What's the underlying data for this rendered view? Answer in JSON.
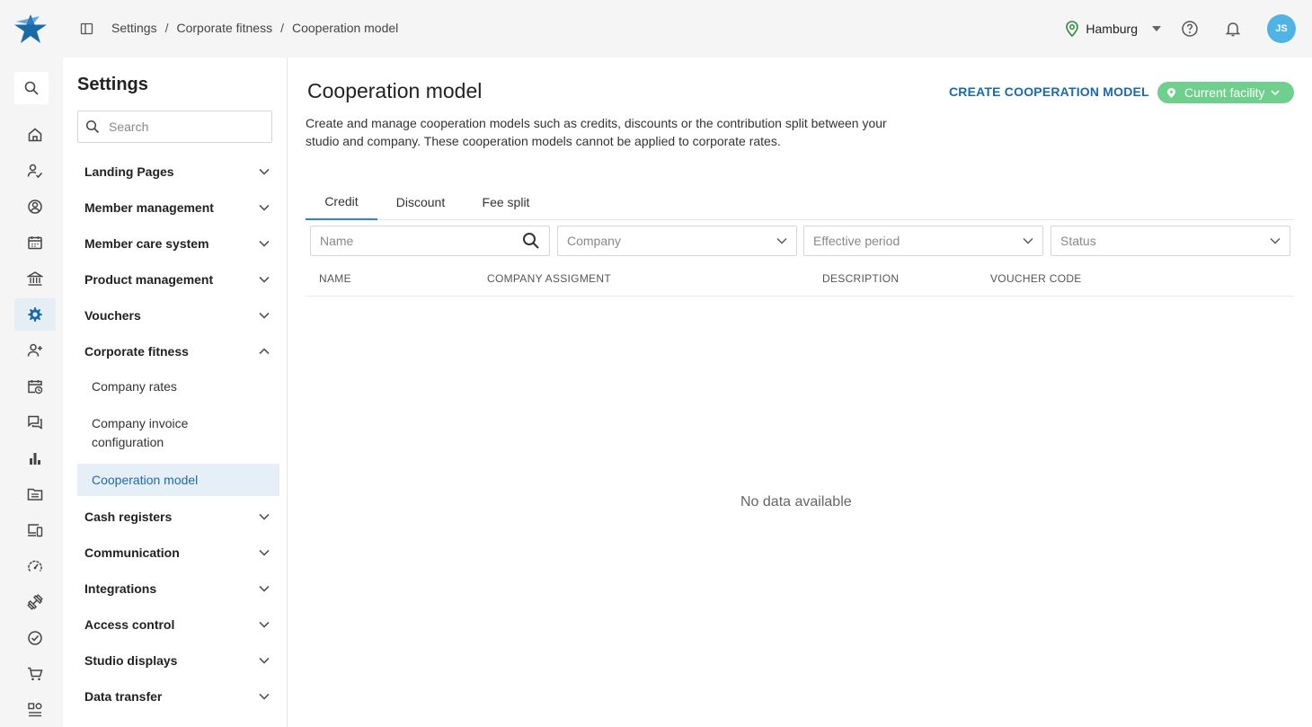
{
  "breadcrumb": [
    "Settings",
    "Corporate fitness",
    "Cooperation model"
  ],
  "header": {
    "location": "Hamburg",
    "avatar_initials": "JS",
    "colors": {
      "avatar": "#4fb3e6",
      "brand": "#1b6aa8",
      "facility": "#6fcf8c"
    }
  },
  "rail": {
    "icons": [
      "search-icon",
      "home-icon",
      "member-check-icon",
      "user-circle-icon",
      "calendar-icon",
      "bank-icon",
      "gear-icon",
      "user-add-icon",
      "calendar-clock-icon",
      "chat-icon",
      "bar-chart-icon",
      "folder-icon",
      "devices-icon",
      "gauge-icon",
      "dumbbell-icon",
      "check-circle-icon",
      "cart-icon",
      "more-icon"
    ],
    "active": "gear-icon"
  },
  "settings": {
    "title": "Settings",
    "search_placeholder": "Search",
    "menu": [
      {
        "label": "Landing Pages",
        "expanded": false
      },
      {
        "label": "Member management",
        "expanded": false
      },
      {
        "label": "Member care system",
        "expanded": false
      },
      {
        "label": "Product management",
        "expanded": false
      },
      {
        "label": "Vouchers",
        "expanded": false
      },
      {
        "label": "Corporate fitness",
        "expanded": true
      },
      {
        "label": "Cash registers",
        "expanded": false
      },
      {
        "label": "Communication",
        "expanded": false
      },
      {
        "label": "Integrations",
        "expanded": false
      },
      {
        "label": "Access control",
        "expanded": false
      },
      {
        "label": "Studio displays",
        "expanded": false
      },
      {
        "label": "Data transfer",
        "expanded": false
      }
    ],
    "sub_items": [
      "Company rates",
      "Company invoice configuration",
      "Cooperation model"
    ],
    "active_sub": "Cooperation model"
  },
  "main": {
    "title": "Cooperation model",
    "create_label": "CREATE COOPERATION MODEL",
    "facility_label": "Current facility",
    "description": "Create and manage cooperation models such as credits, discounts or the contribution split between your studio and company. These cooperation models cannot be applied to corporate rates.",
    "tabs": [
      "Credit",
      "Discount",
      "Fee split"
    ],
    "active_tab": "Credit",
    "filters": {
      "name_placeholder": "Name",
      "company": "Company",
      "period": "Effective period",
      "status": "Status"
    },
    "columns": [
      "NAME",
      "COMPANY ASSIGMENT",
      "DESCRIPTION",
      "VOUCHER CODE"
    ],
    "empty_text": "No data available"
  }
}
